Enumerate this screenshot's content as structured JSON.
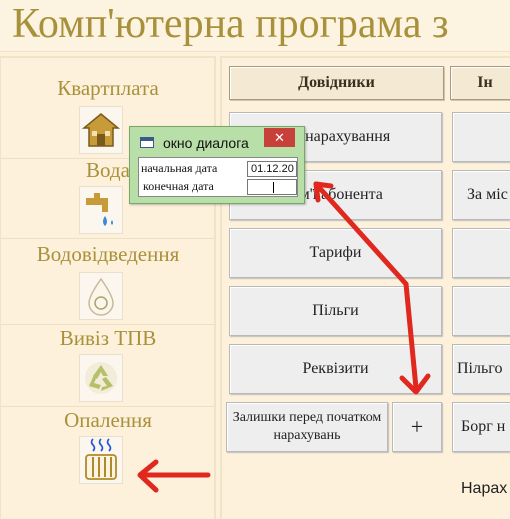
{
  "app": {
    "title": "Комп'ютерна програма з"
  },
  "services": [
    {
      "label": "Квартплата",
      "icon": "house-icon"
    },
    {
      "label": "Вода",
      "icon": "water-tap-icon"
    },
    {
      "label": "Водовідведення",
      "icon": "drop-icon"
    },
    {
      "label": "Вивіз ТПВ",
      "icon": "recycle-icon"
    },
    {
      "label": "Опалення",
      "icon": "radiator-icon"
    }
  ],
  "tabs": [
    {
      "label": "Довідники"
    },
    {
      "label": "Ін"
    }
  ],
  "buttons": {
    "charges": "ки, нарахування",
    "family": "сім'ї абонента",
    "tariffs": "Тарифи",
    "benefits": "Пільги",
    "requisites": "Реквізити",
    "balances": "Залишки перед початком нарахувань",
    "plus": "+",
    "by_place": "За міс",
    "benefit_right": "Пільго",
    "debt": "Борг н"
  },
  "footer": {
    "text": "Нарах"
  },
  "dialog": {
    "title": "окно диалога",
    "close": "✕",
    "start_label": "начальная дата",
    "start_value": "01.12.20",
    "end_label": "конечная дата",
    "end_value": ""
  },
  "colors": {
    "arrow": "#e0281e",
    "title": "#a8913a",
    "dialog_bg": "#b9dfa8"
  }
}
